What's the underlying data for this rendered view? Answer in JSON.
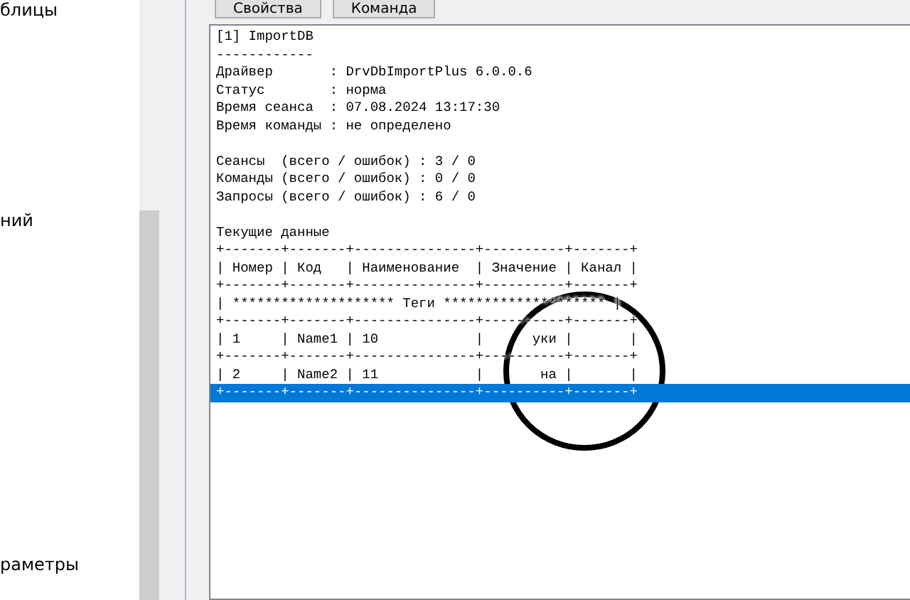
{
  "sidebar": {
    "items": [
      "блицы",
      "ний",
      "раметры"
    ]
  },
  "toolbar": {
    "buttons": [
      "Свойства",
      "Команда"
    ]
  },
  "console": {
    "blocks": [
      [
        {
          "text": "[1] ImportDB",
          "selected": false
        },
        {
          "text": "------------",
          "selected": false
        },
        {
          "text": "Драйвер       : DrvDbImportPlus 6.0.0.6",
          "selected": false
        },
        {
          "text": "Статус        : норма",
          "selected": false
        },
        {
          "text": "Время сеанса  : 07.08.2024 13:17:30",
          "selected": false
        },
        {
          "text": "Время команды : не определено",
          "selected": false
        }
      ],
      [
        {
          "text": "Сеансы  (всего / ошибок) : 3 / 0",
          "selected": false
        },
        {
          "text": "Команды (всего / ошибок) : 0 / 0",
          "selected": false
        },
        {
          "text": "Запросы (всего / ошибок) : 6 / 0",
          "selected": false
        }
      ],
      [
        {
          "text": "Текущие данные",
          "selected": false
        },
        {
          "text": "+-------+-------+---------------+----------+-------+",
          "selected": false
        },
        {
          "text": "| Номер | Код   | Наименование  | Значение | Канал |",
          "selected": false
        },
        {
          "text": "+-------+-------+---------------+----------+-------+",
          "selected": false
        },
        {
          "text": "| ******************** Теги ******************** |",
          "selected": false
        },
        {
          "text": "+-------+-------+---------------+----------+-------+",
          "selected": false
        },
        {
          "text": "| 1     | Name1 | 10            |      уки |       |",
          "selected": false
        },
        {
          "text": "+-------+-------+---------------+----------+-------+",
          "selected": false
        },
        {
          "text": "| 2     | Name2 | 11            |       на |       |",
          "selected": false
        },
        {
          "text": "+-------+-------+---------------+----------+-------+",
          "selected": true
        }
      ]
    ]
  }
}
